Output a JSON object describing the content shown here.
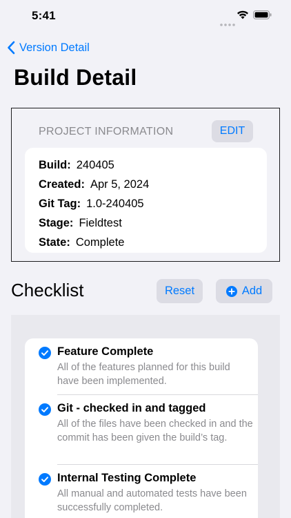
{
  "status_bar": {
    "time": "5:41"
  },
  "nav": {
    "back_label": "Version Detail"
  },
  "page": {
    "title": "Build Detail"
  },
  "project": {
    "header": "PROJECT INFORMATION",
    "edit_label": "EDIT",
    "fields": [
      {
        "label": "Build:",
        "value": "240405"
      },
      {
        "label": "Created:",
        "value": "Apr 5, 2024"
      },
      {
        "label": "Git Tag:",
        "value": "1.0-240405"
      },
      {
        "label": "Stage:",
        "value": "Fieldtest"
      },
      {
        "label": "State:",
        "value": "Complete"
      }
    ]
  },
  "checklist": {
    "title": "Checklist",
    "reset_label": "Reset",
    "add_label": "Add",
    "items": [
      {
        "title": "Feature Complete",
        "description": "All of the features planned for this build have been implemented.",
        "checked": true
      },
      {
        "title": "Git - checked in and tagged",
        "description": "All of the files have been checked in and the commit has been given the build’s tag.",
        "checked": true
      },
      {
        "title": "Internal Testing Complete",
        "description": "All manual and automated tests have been successfully completed.",
        "checked": true
      }
    ]
  },
  "colors": {
    "accent": "#007aff",
    "background": "#f2f2f7",
    "secondary_text": "#8a8a8e"
  }
}
